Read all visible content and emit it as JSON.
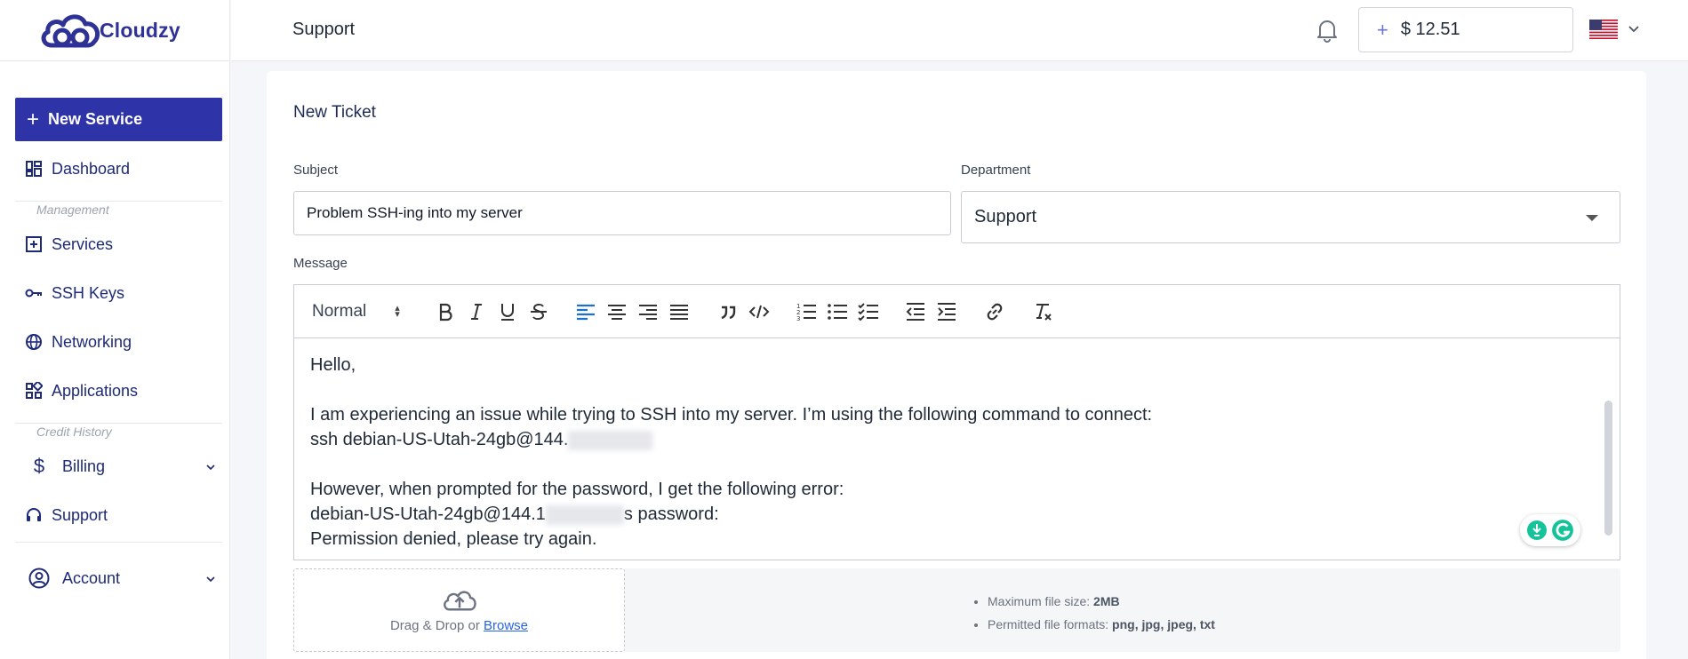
{
  "app": {
    "brand": "Cloudzy",
    "brand_color": "#2e3196",
    "accent_color": "#2e33a8"
  },
  "sidebar": {
    "new_service_label": "New Service",
    "dashboard_label": "Dashboard",
    "management_section": "Management",
    "services_label": "Services",
    "ssh_keys_label": "SSH Keys",
    "networking_label": "Networking",
    "applications_label": "Applications",
    "credit_history_section": "Credit History",
    "billing_label": "Billing",
    "support_label": "Support",
    "account_label": "Account"
  },
  "header": {
    "title": "Support",
    "balance": "$ 12.51",
    "locale_flag": "us-flag-icon"
  },
  "ticket": {
    "title": "New Ticket",
    "subject_label": "Subject",
    "subject_value": "Problem SSH-ing into my server",
    "department_label": "Department",
    "department_value": "Support",
    "message_label": "Message",
    "format_select": "Normal",
    "message_lines": [
      "Hello,",
      "",
      "I am experiencing an issue while trying to SSH into my server. I’m using the following command to connect:",
      "ssh debian-US-Utah-24gb@144.",
      "",
      "However, when prompted for the password, I get the following error:",
      "debian-US-Utah-24gb@144.1",
      "Permission denied, please try again."
    ],
    "line7_suffix": "s password:"
  },
  "upload": {
    "drop_text": "Drag & Drop or ",
    "browse_label": "Browse",
    "max_size_label": "Maximum file size: ",
    "max_size_value": "2MB",
    "formats_label": "Permitted file formats: ",
    "formats_value": "png, jpg, jpeg, txt"
  }
}
